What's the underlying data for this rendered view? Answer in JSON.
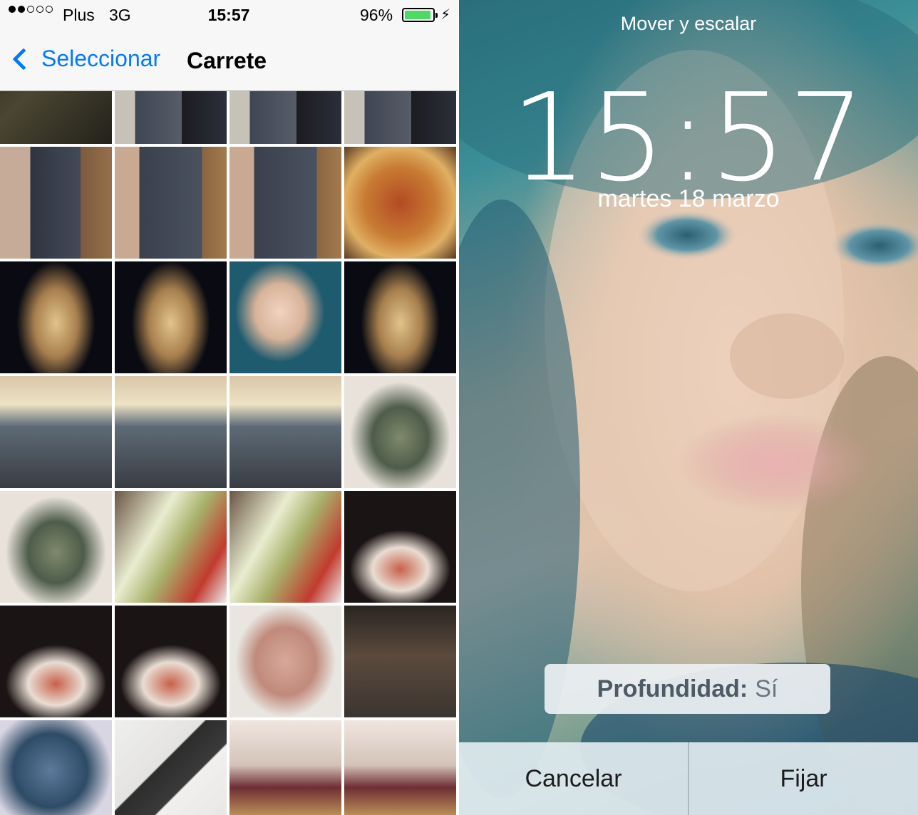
{
  "left_panel": {
    "status": {
      "carrier": "Plus",
      "network": "3G",
      "time": "15:57",
      "battery_percent": "96%",
      "battery_level": 0.96,
      "bolt": "⚡"
    },
    "navbar": {
      "back_label": "Seleccionar",
      "title": "Carrete"
    },
    "photos": [
      "dark-texture",
      "man-in-hallway",
      "man-in-hallway",
      "man-in-hallway",
      "man-by-door",
      "gray-wall-panel",
      "gray-wall-panel",
      "pizza",
      "christmas-tree-night",
      "christmas-tree-night",
      "woman-selfie",
      "christmas-tree-night",
      "man-with-champagne",
      "man-with-champagne",
      "man-with-champagne",
      "decorated-tree-indoor",
      "decorated-tree-indoor",
      "champagne-toast",
      "champagne-toast",
      "wine-and-ham",
      "wine-and-ham",
      "wine-and-ham",
      "man-face-closeup",
      "group-night",
      "tree-and-gifts",
      "bottle-opener",
      "food-tray",
      "food-tray"
    ]
  },
  "right_panel": {
    "header": "Mover y escalar",
    "clock": "15:57",
    "date": "martes 18 marzo",
    "depth_label": "Profundidad:",
    "depth_value": "Sí",
    "cancel_label": "Cancelar",
    "set_label": "Fijar"
  },
  "colors": {
    "accent": "#007aff",
    "battery": "#4cd964"
  }
}
